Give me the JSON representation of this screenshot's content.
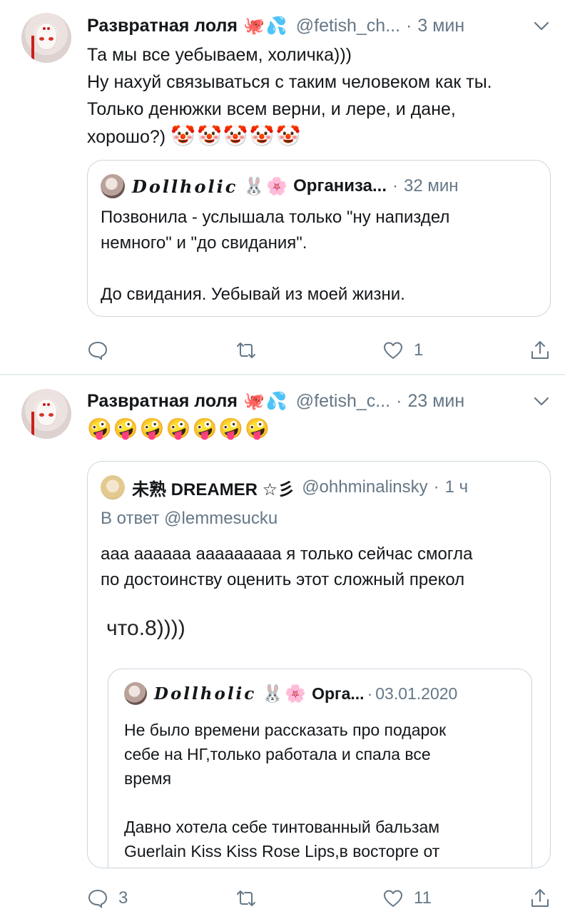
{
  "tweets": [
    {
      "author": {
        "name": "Развратная лоля",
        "emoji": "🐙💦",
        "handle": "@fetish_ch...",
        "time": "3 мин"
      },
      "text": "Та мы все уебываем, холичка)))\nНу нахуй связываться с таким человеком как ты.\nТолько денюжки всем верни, и лере, и дане,\nхорошо?) ",
      "text_emoji": "🤡🤡🤡🤡🤡",
      "quote": {
        "name_script": "Dollholic",
        "name_emoji": "🐰🌸",
        "name_rest": "Организа...",
        "time": "32 мин",
        "text": "Позвонила - услышала только \"ну напиздел\nнемного\" и \"до свидания\".\n\nДо свидания. Уебывай из моей жизни."
      },
      "actions": {
        "reply_icon": "reply-icon",
        "retweet_icon": "retweet-icon",
        "like_icon": "heart-icon",
        "like_count": "1",
        "share_icon": "share-icon"
      }
    },
    {
      "author": {
        "name": "Развратная лоля",
        "emoji": "🐙💦",
        "handle": "@fetish_c...",
        "time": "23 мин"
      },
      "text": "🤪🤪🤪🤪🤪🤪🤪",
      "quote": {
        "name": "未熟 DREAMER ☆彡",
        "handle": "@ohhminalinsky",
        "time": "1 ч",
        "reply_to": "В ответ @lemmesucku",
        "text": "ааа аааааа ааааааааа я только сейчас смогла\nпо достоинству оценить этот сложный прекол",
        "big_text": "что.8))))",
        "inner_quote": {
          "name_script": "Dollholic",
          "name_emoji": "🐰🌸",
          "name_rest": "Орга...",
          "time": "03.01.2020",
          "text": "Не было времени рассказать про подарок\nсебе на НГ,только работала и спала все\nвремя\n\nДавно хотела себе тинтованный бальзам\nGuerlain Kiss Kiss Rose Lips,в восторге от"
        }
      },
      "actions": {
        "reply_icon": "reply-icon",
        "reply_count": "3",
        "retweet_icon": "retweet-icon",
        "like_icon": "heart-icon",
        "like_count": "11",
        "share_icon": "share-icon"
      }
    }
  ],
  "separator": "·",
  "colors": {
    "secondary_text": "#657786",
    "border": "#ccd6dd",
    "divider": "#e6ecf0",
    "primary_text": "#14171a"
  }
}
